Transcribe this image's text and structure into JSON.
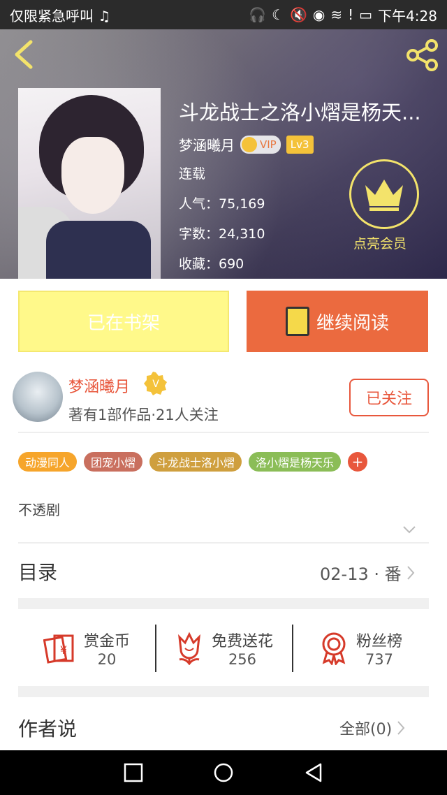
{
  "status_bar": {
    "left_text": "仅限紧急呼叫",
    "time": "下午4:28"
  },
  "book": {
    "title": "斗龙战士之洛小熠是杨天...",
    "author": "梦涵曦月",
    "vip_label": "VIP",
    "level": "Lv3",
    "status": "连载",
    "popularity": "人气：75,169",
    "word_count": "字数：24,310",
    "favorites": "收藏：690"
  },
  "member_label": "点亮会员",
  "actions": {
    "shelf": "已在书架",
    "continue": "继续阅读"
  },
  "author_card": {
    "name": "梦涵曦月",
    "desc": "著有1部作品·21人关注",
    "follow": "已关注"
  },
  "tags": [
    {
      "label": "动漫同人",
      "color": "#f6a52b"
    },
    {
      "label": "团宠小熠",
      "color": "#c96f5e"
    },
    {
      "label": "斗龙战士洛小熠",
      "color": "#cf9f3e"
    },
    {
      "label": "洛小熠是杨天乐",
      "color": "#8bbd57"
    }
  ],
  "tag_more": "+",
  "description": "不透剧",
  "toc": {
    "label": "目录",
    "latest": "02-13 · 番"
  },
  "stats": [
    {
      "label": "赏金币",
      "value": "20",
      "icon": "red-envelope-icon"
    },
    {
      "label": "免费送花",
      "value": "256",
      "icon": "flower-icon"
    },
    {
      "label": "粉丝榜",
      "value": "737",
      "icon": "medal-icon"
    }
  ],
  "author_says": {
    "label": "作者说",
    "all": "全部(0)"
  },
  "colors": {
    "accent": "#e8573c",
    "read_button": "#eb6a3f",
    "shelf_button": "#fff98a",
    "member_gold": "#f3e36b"
  }
}
